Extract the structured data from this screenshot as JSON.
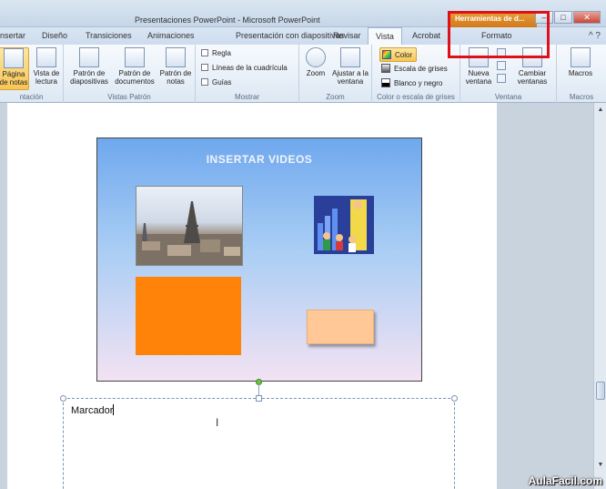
{
  "window": {
    "title": "Presentaciones PowerPoint - Microsoft PowerPoint",
    "context_tab_header": "Herramientas de d...",
    "controls": [
      "–",
      "□",
      "✕"
    ]
  },
  "tabs": [
    "nsertar",
    "Diseño",
    "Transiciones",
    "Animaciones",
    "Presentación con diapositivas",
    "Revisar",
    "Vista",
    "Acrobat",
    "Formato"
  ],
  "active_tab": "Vista",
  "ribbon": {
    "groups": {
      "presentation_views": {
        "label": "ntación",
        "buttons": [
          {
            "label": "Página de notas",
            "selected": true,
            "icon": "notes-page-icon"
          },
          {
            "label": "Vista de lectura",
            "selected": false,
            "icon": "reading-view-icon"
          }
        ]
      },
      "master_views": {
        "label": "Vistas Patrón",
        "buttons": [
          {
            "label": "Patrón de diapositivas",
            "icon": "slide-master-icon"
          },
          {
            "label": "Patrón de documentos",
            "icon": "handout-master-icon"
          },
          {
            "label": "Patrón de notas",
            "icon": "notes-master-icon"
          }
        ]
      },
      "show": {
        "label": "Mostrar",
        "checkboxes": [
          "Regla",
          "Líneas de la cuadrícula",
          "Guías"
        ]
      },
      "zoom": {
        "label": "Zoom",
        "buttons": [
          {
            "label": "Zoom",
            "icon": "zoom-icon"
          },
          {
            "label": "Ajustar a la ventana",
            "icon": "fit-window-icon"
          }
        ]
      },
      "color": {
        "label": "Color o escala de grises",
        "options": [
          {
            "label": "Color",
            "selected": true
          },
          {
            "label": "Escala de grises",
            "selected": false
          },
          {
            "label": "Blanco y negro",
            "selected": false
          }
        ]
      },
      "window": {
        "label": "Ventana",
        "buttons": [
          {
            "label": "Nueva ventana",
            "icon": "new-window-icon"
          },
          {
            "label": "Cambiar ventanas",
            "icon": "switch-windows-icon"
          }
        ]
      },
      "macros": {
        "label": "Macros",
        "buttons": [
          {
            "label": "Macros",
            "icon": "macros-icon"
          }
        ]
      }
    }
  },
  "slide": {
    "title": "INSERTAR VIDEOS"
  },
  "notes": {
    "text": "Marcador"
  },
  "watermark": "AulaFacil.com",
  "colors": {
    "accent_red_box": "#e0101a",
    "orange_shape": "#ff8308",
    "peach_shape": "#ffc896",
    "context_header": "#e8a23a"
  }
}
